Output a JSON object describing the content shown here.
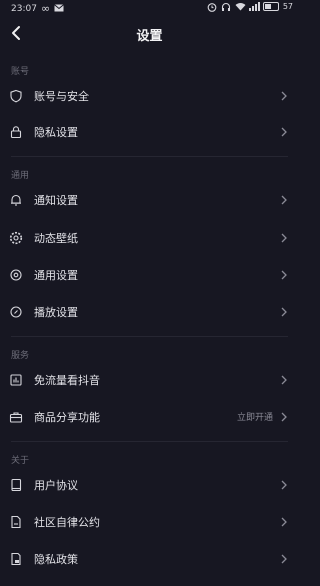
{
  "status_bar": {
    "time": "23:07",
    "network": "∞",
    "battery_text": "57",
    "battery_level": 0.57,
    "left_icons": [
      "infinity-icon",
      "mail-icon"
    ],
    "right_icons": [
      "alarm-icon",
      "headset-icon",
      "wifi-icon",
      "signal-icon",
      "battery-icon"
    ]
  },
  "header": {
    "title": "设置",
    "back_icon": "back-arrow-icon"
  },
  "sections": [
    {
      "label": "账号",
      "items": [
        {
          "label": "账号与安全",
          "icon": "shield-icon"
        },
        {
          "label": "隐私设置",
          "icon": "lock-icon"
        }
      ]
    },
    {
      "label": "通用",
      "items": [
        {
          "label": "通知设置",
          "icon": "bell-icon"
        },
        {
          "label": "动态壁纸",
          "icon": "gear-icon"
        },
        {
          "label": "通用设置",
          "icon": "settings-circle-icon"
        },
        {
          "label": "播放设置",
          "icon": "play-circle-icon"
        }
      ]
    },
    {
      "label": "服务",
      "items": [
        {
          "label": "免流量看抖音",
          "icon": "data-chart-icon"
        },
        {
          "label": "商品分享功能",
          "icon": "briefcase-icon",
          "extra": "立即开通"
        }
      ]
    },
    {
      "label": "关于",
      "items": [
        {
          "label": "用户协议",
          "icon": "book-icon"
        },
        {
          "label": "社区自律公约",
          "icon": "document-icon"
        },
        {
          "label": "隐私政策",
          "icon": "privacy-lock-icon"
        }
      ]
    }
  ],
  "colors": {
    "background": "#171722",
    "text": "#e3e3e8",
    "muted": "#6c6c78"
  }
}
